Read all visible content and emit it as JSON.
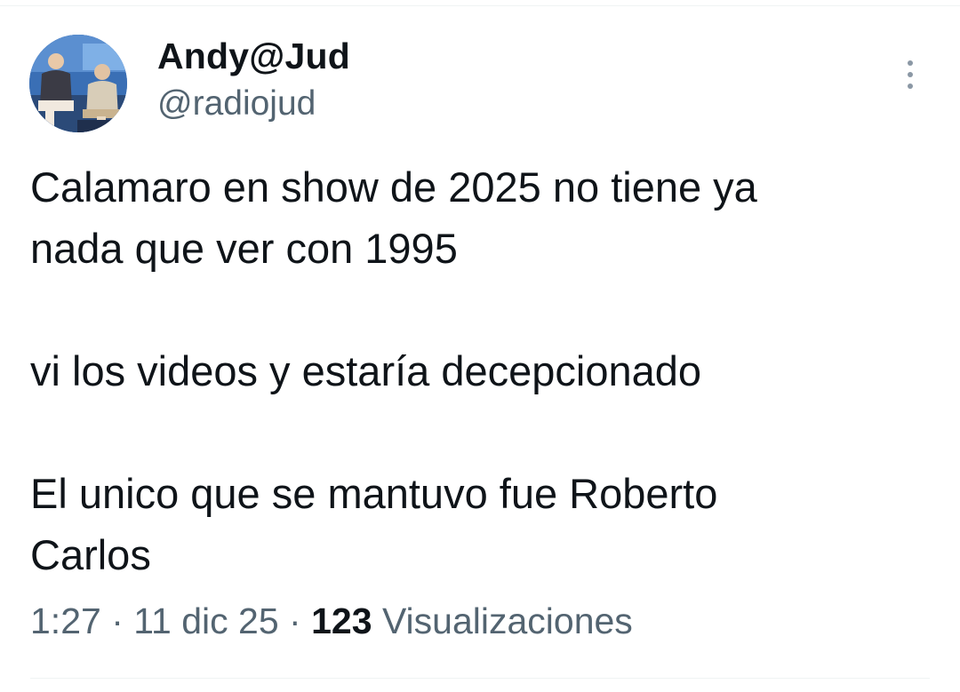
{
  "tweet": {
    "author": {
      "display_name": "Andy@Jud",
      "handle": "@radiojud"
    },
    "text_lines": [
      "Calamaro en show de 2025 no tiene ya",
      "nada que ver con 1995",
      "vi los videos y estaría decepcionado",
      "El unico que se mantuvo fue Roberto",
      "Carlos"
    ],
    "meta": {
      "time": "1:27",
      "separator": "·",
      "date": "11 dic 25",
      "views_count": "123",
      "views_label": "Visualizaciones"
    },
    "more_icon": "more-vertical-icon"
  },
  "colors": {
    "text_primary": "#0f1419",
    "text_secondary": "#536471",
    "divider": "#eff3f4",
    "more_icon": "#8b98a5"
  }
}
